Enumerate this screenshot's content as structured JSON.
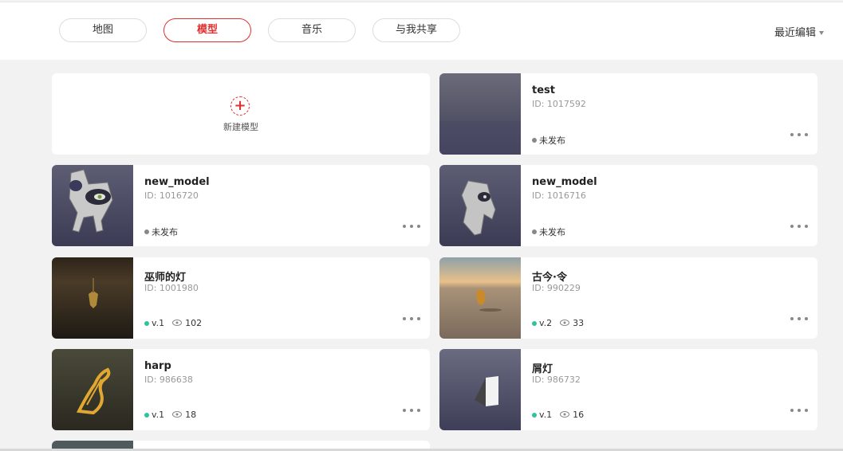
{
  "tabs": [
    {
      "label": "地图",
      "active": false
    },
    {
      "label": "模型",
      "active": true
    },
    {
      "label": "音乐",
      "active": false
    },
    {
      "label": "与我共享",
      "active": false
    }
  ],
  "sort": {
    "label": "最近编辑"
  },
  "new_model": {
    "label": "新建模型",
    "icon": "plus-icon"
  },
  "models": [
    {
      "name": "test",
      "id": "ID: 1017592",
      "status": "未发布",
      "published": false
    },
    {
      "name": "new_model",
      "id": "ID: 1016720",
      "status": "未发布",
      "published": false
    },
    {
      "name": "new_model",
      "id": "ID: 1016716",
      "status": "未发布",
      "published": false
    },
    {
      "name": "巫师的灯",
      "id": "ID: 1001980",
      "version": "v.1",
      "views": "102",
      "published": true
    },
    {
      "name": "古今·令",
      "id": "ID: 990229",
      "version": "v.2",
      "views": "33",
      "published": true
    },
    {
      "name": "harp",
      "id": "ID: 986638",
      "version": "v.1",
      "views": "18",
      "published": true
    },
    {
      "name": "屑灯",
      "id": "ID: 986732",
      "version": "v.1",
      "views": "16",
      "published": true
    }
  ],
  "colors": {
    "accent": "#e23030",
    "published_dot": "#2dc49b",
    "unpublished_dot": "#888888"
  }
}
